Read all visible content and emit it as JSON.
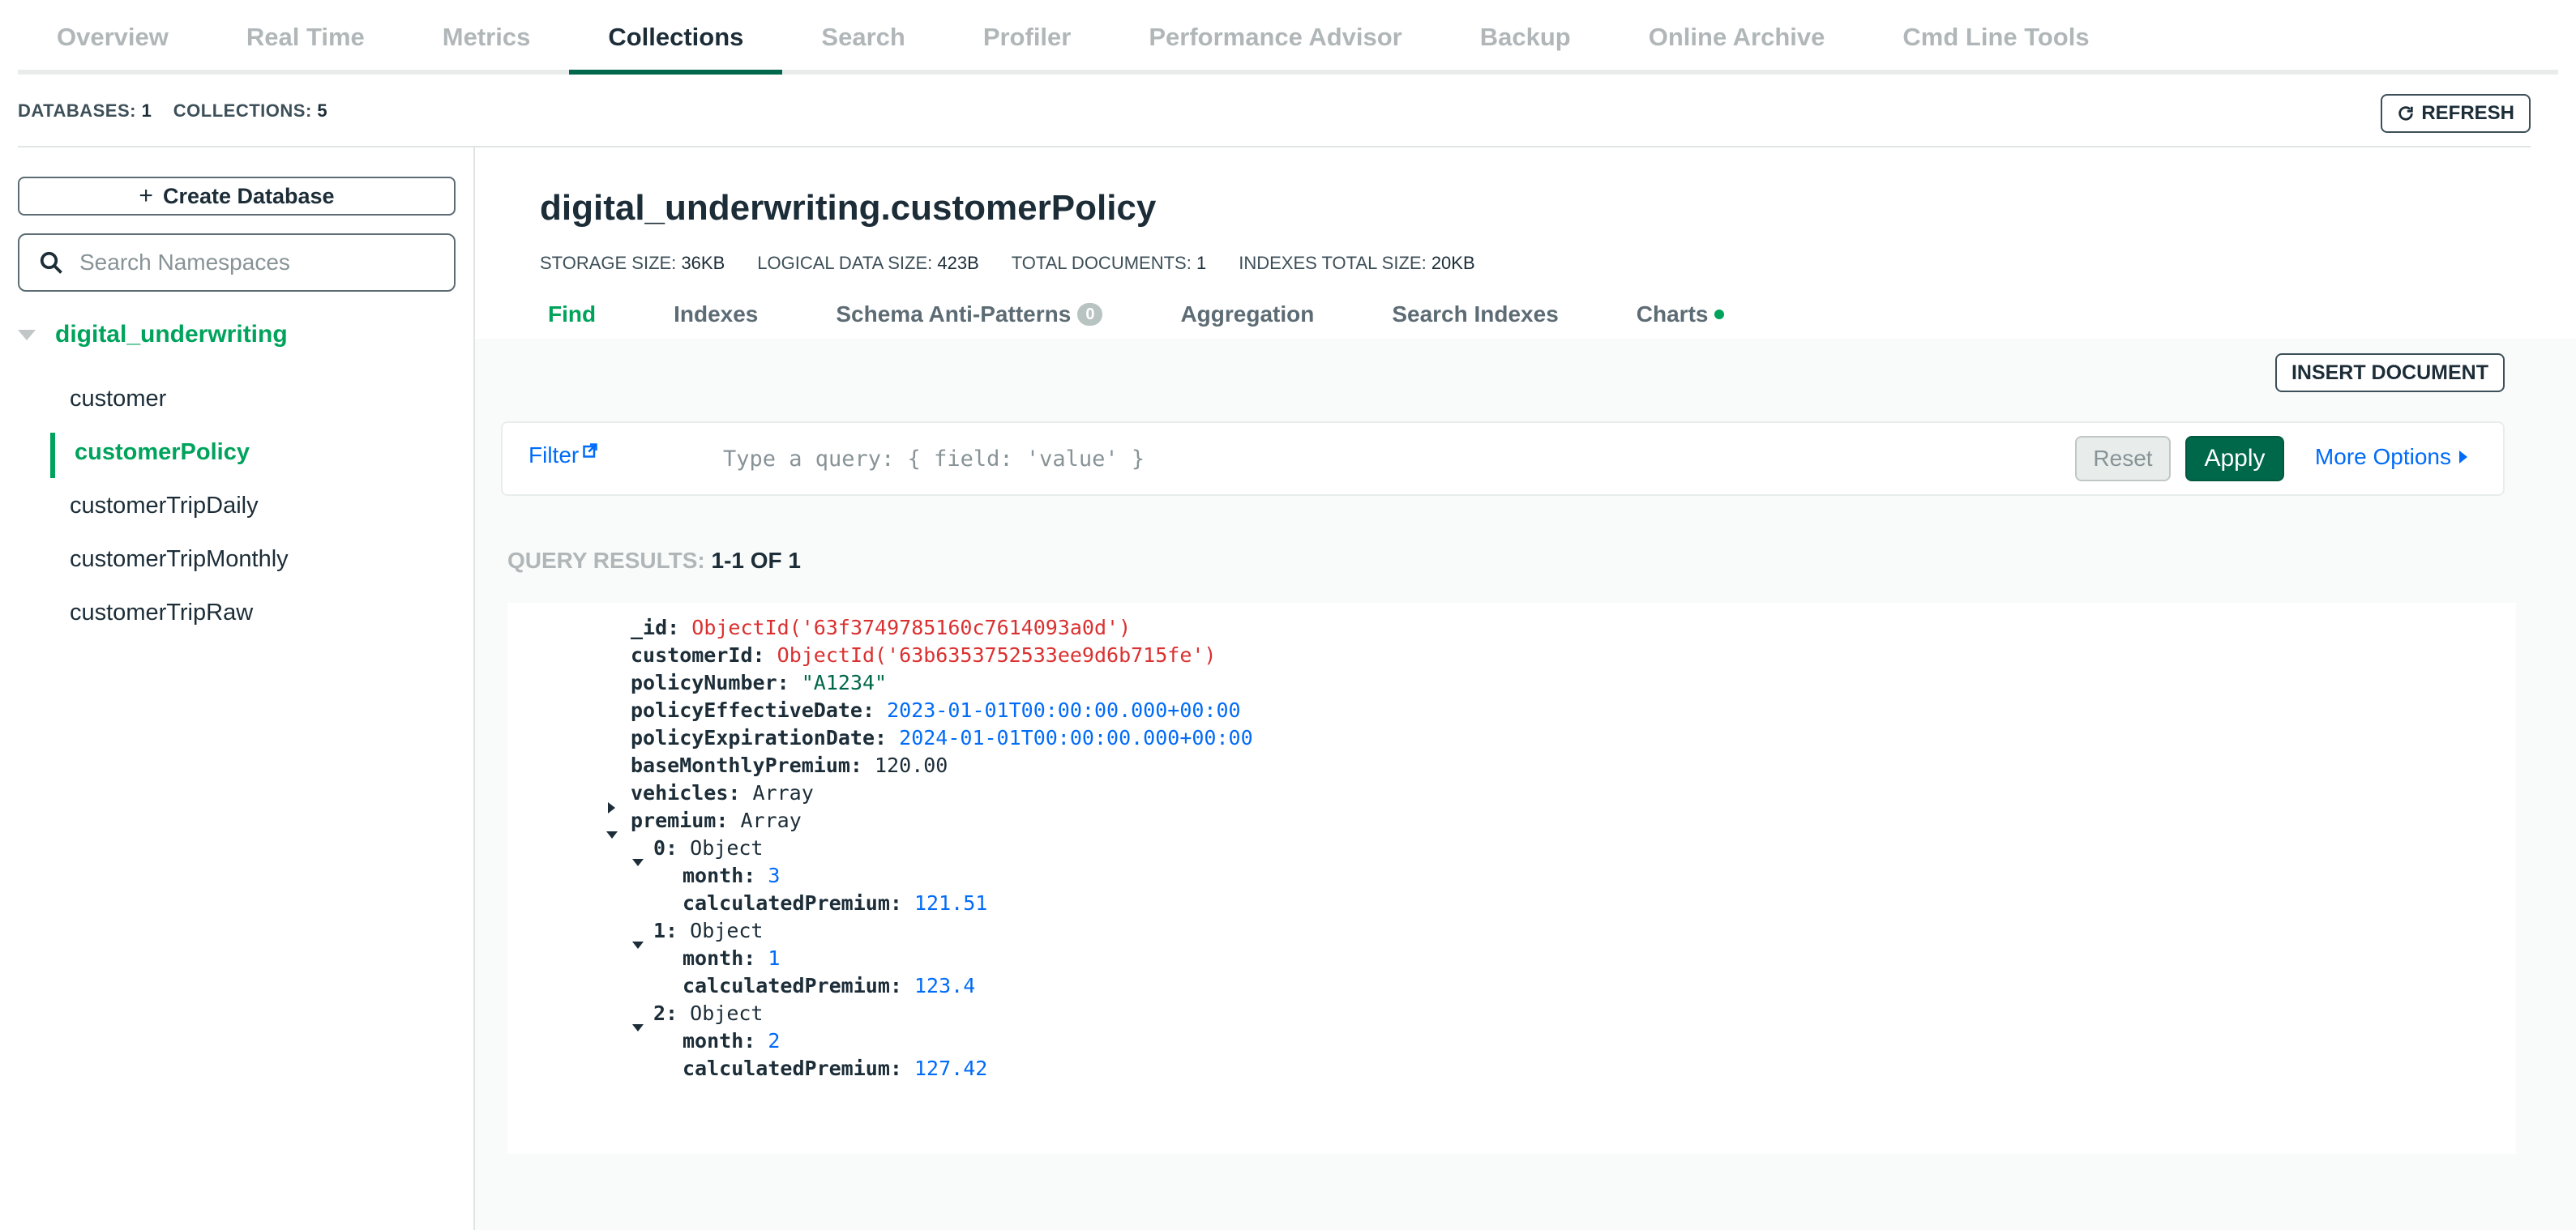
{
  "top_tabs": [
    "Overview",
    "Real Time",
    "Metrics",
    "Collections",
    "Search",
    "Profiler",
    "Performance Advisor",
    "Backup",
    "Online Archive",
    "Cmd Line Tools"
  ],
  "top_tabs_active": "Collections",
  "stats": {
    "databases_label": "DATABASES:",
    "databases": "1",
    "collections_label": "COLLECTIONS:",
    "collections": "5"
  },
  "refresh_label": "REFRESH",
  "sidebar": {
    "create_db_label": "Create Database",
    "search_placeholder": "Search Namespaces",
    "database": "digital_underwriting",
    "collections": [
      "customer",
      "customerPolicy",
      "customerTripDaily",
      "customerTripMonthly",
      "customerTripRaw"
    ],
    "active_collection": "customerPolicy"
  },
  "namespace": {
    "title": "digital_underwriting.customerPolicy",
    "storage_label": "STORAGE SIZE:",
    "storage": "36KB",
    "logical_label": "LOGICAL DATA SIZE:",
    "logical": "423B",
    "docs_label": "TOTAL DOCUMENTS:",
    "docs": "1",
    "indexes_label": "INDEXES TOTAL SIZE:",
    "indexes": "20KB"
  },
  "sub_tabs": {
    "find": "Find",
    "indexes": "Indexes",
    "schema": "Schema Anti-Patterns",
    "schema_count": "0",
    "aggregation": "Aggregation",
    "search_indexes": "Search Indexes",
    "charts": "Charts"
  },
  "insert_document_label": "INSERT DOCUMENT",
  "filter": {
    "label": "Filter",
    "placeholder": "Type a query: { field: 'value' }",
    "reset": "Reset",
    "apply": "Apply",
    "more_options": "More Options"
  },
  "query_results": {
    "label": "QUERY RESULTS:",
    "value": "1-1 OF 1"
  },
  "document": {
    "id_key": "_id:",
    "id_val": "ObjectId('63f3749785160c7614093a0d')",
    "cust_key": "customerId:",
    "cust_val": "ObjectId('63b6353752533ee9d6b715fe')",
    "policy_key": "policyNumber:",
    "policy_val": "\"A1234\"",
    "eff_key": "policyEffectiveDate:",
    "eff_val": "2023-01-01T00:00:00.000+00:00",
    "exp_key": "policyExpirationDate:",
    "exp_val": "2024-01-01T00:00:00.000+00:00",
    "base_key": "baseMonthlyPremium:",
    "base_val": "120.00",
    "vehicles_key": "vehicles:",
    "vehicles_val": "Array",
    "premium_key": "premium:",
    "premium_val": "Array",
    "items": [
      {
        "idx": "0:",
        "type": "Object",
        "month_key": "month:",
        "month": "3",
        "calc_key": "calculatedPremium:",
        "calc": "121.51"
      },
      {
        "idx": "1:",
        "type": "Object",
        "month_key": "month:",
        "month": "1",
        "calc_key": "calculatedPremium:",
        "calc": "123.4"
      },
      {
        "idx": "2:",
        "type": "Object",
        "month_key": "month:",
        "month": "2",
        "calc_key": "calculatedPremium:",
        "calc": "127.42"
      }
    ]
  }
}
